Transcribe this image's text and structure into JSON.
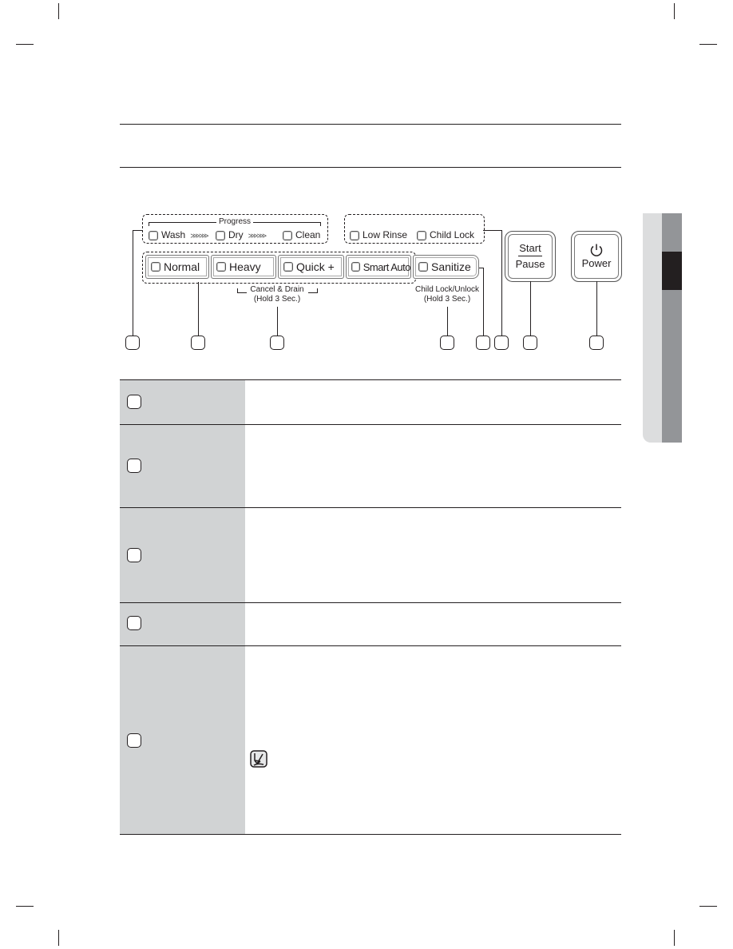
{
  "panel": {
    "progress_group": {
      "title": "Progress",
      "indicators": [
        {
          "label": "Wash",
          "arrows": "⋙⋙"
        },
        {
          "label": "Dry",
          "arrows": "⋙⋙"
        },
        {
          "label": "Clean"
        }
      ]
    },
    "option_indicators": [
      {
        "label": "Low Rinse"
      },
      {
        "label": "Child Lock"
      }
    ],
    "cycle_buttons": [
      {
        "label": "Normal"
      },
      {
        "label": "Heavy"
      },
      {
        "label": "Quick +"
      },
      {
        "label": "Smart Auto"
      }
    ],
    "sanitize_button": {
      "label": "Sanitize"
    },
    "cancel_drain_note": {
      "line1": "Cancel & Drain",
      "line2": "(Hold 3 Sec.)"
    },
    "child_lock_note": {
      "line1": "Child Lock/Unlock",
      "line2": "(Hold 3 Sec.)"
    },
    "start_pause_button": {
      "top": "Start",
      "bottom": "Pause"
    },
    "power_button": {
      "icon": "power-icon",
      "label": "Power"
    }
  },
  "callouts": [
    "",
    "",
    "",
    "",
    "",
    "",
    "",
    ""
  ],
  "table": {
    "rows": [
      {
        "callout": "",
        "description": ""
      },
      {
        "callout": "",
        "description": ""
      },
      {
        "callout": "",
        "description": ""
      },
      {
        "callout": "",
        "description": ""
      },
      {
        "callout": "",
        "description": "",
        "note_icon": "note-pencil-icon"
      }
    ]
  },
  "side_tab": {
    "colors": {
      "light": "#dcddde",
      "mid": "#939598",
      "dark": "#231f20"
    }
  },
  "colors": {
    "table_left_bg": "#d1d3d4",
    "ink": "#231f20"
  }
}
